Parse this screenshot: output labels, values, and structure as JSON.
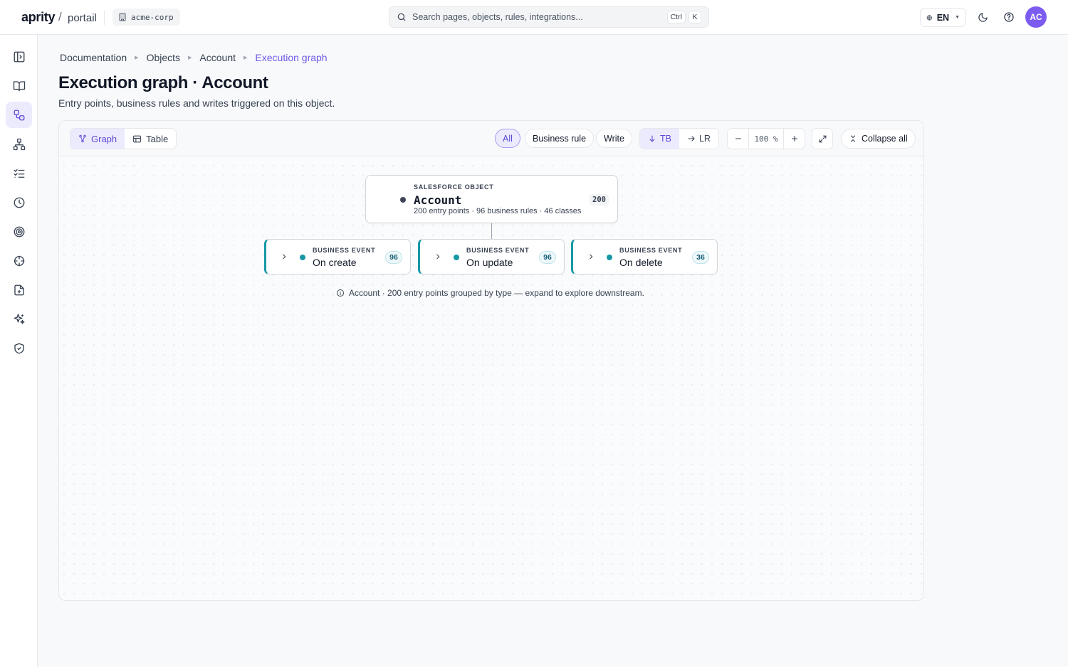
{
  "topbar": {
    "brand": "aprity",
    "separator": "/",
    "brand_sub": "portail",
    "org": "acme-corp",
    "search_placeholder": "Search pages, objects, rules, integrations...",
    "search_shortcut": [
      "Ctrl",
      "K"
    ],
    "language": "EN",
    "avatar_initials": "AC",
    "accent_color": "#7c5cf0"
  },
  "sidebar": {
    "items": [
      {
        "icon": "sidebar-toggle-icon",
        "active": false
      },
      {
        "icon": "book-icon",
        "active": false
      },
      {
        "icon": "workflow-icon",
        "active": true
      },
      {
        "icon": "hierarchy-icon",
        "active": false
      },
      {
        "icon": "checklist-icon",
        "active": false
      },
      {
        "icon": "clock-icon",
        "active": false
      },
      {
        "icon": "target-icon",
        "active": false
      },
      {
        "icon": "crosshair-icon",
        "active": false
      },
      {
        "icon": "file-plus-icon",
        "active": false
      },
      {
        "icon": "sparkles-icon",
        "active": false
      },
      {
        "icon": "shield-check-icon",
        "active": false
      }
    ]
  },
  "breadcrumb": [
    "Documentation",
    "Objects",
    "Account",
    "Execution graph"
  ],
  "page": {
    "title": "Execution graph · Account",
    "subtitle": "Entry points, business rules and writes triggered on this object."
  },
  "toolbar": {
    "views": [
      "Graph",
      "Table"
    ],
    "active_view": "Graph",
    "filters": [
      "All",
      "Business rule",
      "Write"
    ],
    "active_filter": "All",
    "directions": [
      "TB",
      "LR"
    ],
    "active_direction": "TB",
    "zoom": "100 %",
    "collapse_label": "Collapse all"
  },
  "graph": {
    "root": {
      "kicker": "SALESFORCE OBJECT",
      "title": "Account",
      "meta": "200 entry points · 96 business rules · 46 classes",
      "count": "200"
    },
    "events": [
      {
        "kicker": "BUSINESS EVENT",
        "title": "On create",
        "count": "96"
      },
      {
        "kicker": "BUSINESS EVENT",
        "title": "On update",
        "count": "96"
      },
      {
        "kicker": "BUSINESS EVENT",
        "title": "On delete",
        "count": "36"
      }
    ],
    "event_color": "#1697a6",
    "hint": "Account · 200 entry points grouped by type — expand to explore downstream."
  }
}
